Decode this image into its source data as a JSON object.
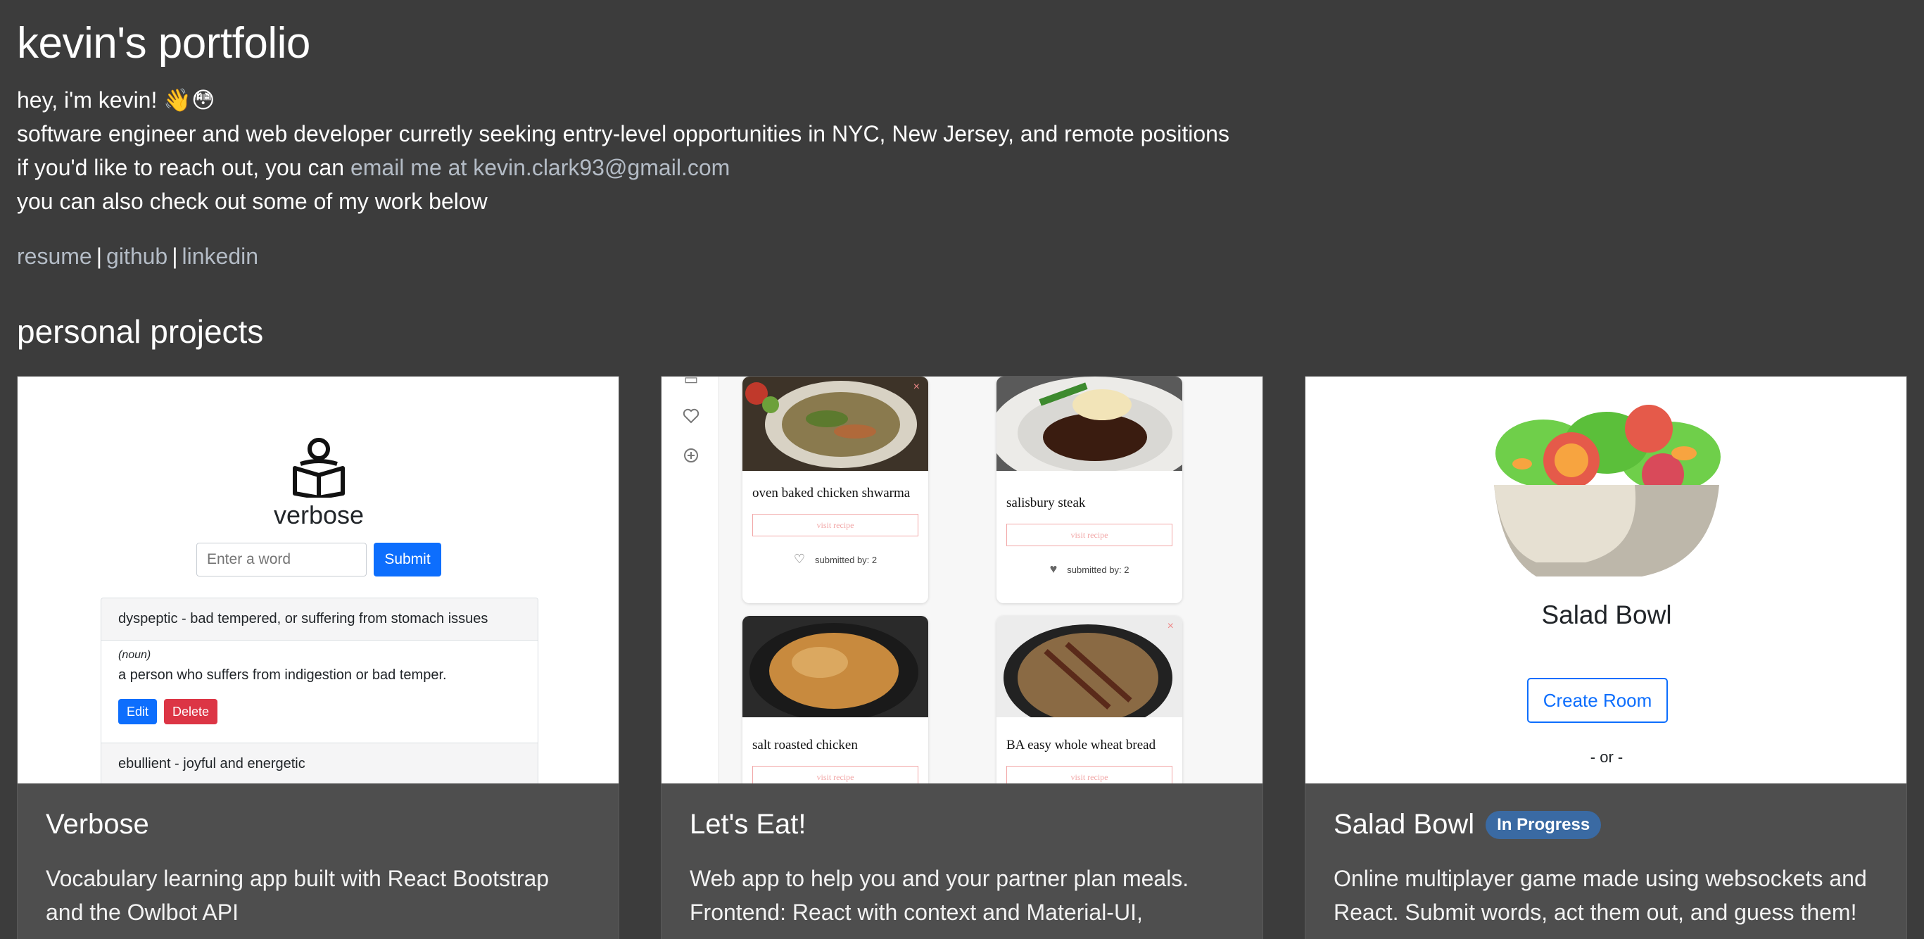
{
  "header": {
    "title": "kevin's portfolio",
    "greeting": "hey, i'm kevin! 👋😳",
    "tagline": "software engineer and web developer curretly seeking entry-level opportunities in NYC, New Jersey, and remote positions",
    "reach_prefix": "if you'd like to reach out, you can ",
    "email_link": "email me at kevin.clark93@gmail.com",
    "work_line": "you can also check out some of my work below"
  },
  "links": {
    "resume": "resume",
    "sep": "|",
    "github": "github",
    "linkedin": "linkedin"
  },
  "section": {
    "title": "personal projects"
  },
  "projects": [
    {
      "title": "Verbose",
      "description": "Vocabulary learning app built with React Bootstrap and the Owlbot API",
      "screenshot": {
        "app_name": "verbose",
        "input_placeholder": "Enter a word",
        "submit_label": "Submit",
        "entries": [
          {
            "header": "dyspeptic - bad tempered, or suffering from stomach issues",
            "pos": "(noun)",
            "definition": "a person who suffers from indigestion or bad temper.",
            "edit": "Edit",
            "delete": "Delete"
          },
          {
            "header": "ebullient - joyful and energetic"
          }
        ]
      }
    },
    {
      "title": "Let's Eat!",
      "description": "Web app to help you and your partner plan meals. Frontend: React with context and Material-UI,",
      "screenshot": {
        "recipes": [
          {
            "name": "oven baked chicken shwarma",
            "visit": "visit recipe",
            "submitted": "submitted by: 2"
          },
          {
            "name": "salisbury steak",
            "visit": "visit recipe",
            "submitted": "submitted by: 2"
          },
          {
            "name": "salt roasted chicken",
            "visit": "visit recipe"
          },
          {
            "name": "BA easy whole wheat bread",
            "visit": "visit recipe"
          }
        ]
      }
    },
    {
      "title": "Salad Bowl",
      "badge": "In Progress",
      "description": "Online multiplayer game made using websockets and React. Submit words, act them out, and guess them!",
      "screenshot": {
        "app_name": "Salad Bowl",
        "create_room": "Create Room",
        "or": "- or -"
      }
    }
  ],
  "colors": {
    "background": "#3c3c3c",
    "card_body": "#4e4e4e",
    "link": "#b4bcc6",
    "badge": "#3a6aa3",
    "bootstrap_primary": "#0d6efd",
    "bootstrap_danger": "#dc3545"
  }
}
